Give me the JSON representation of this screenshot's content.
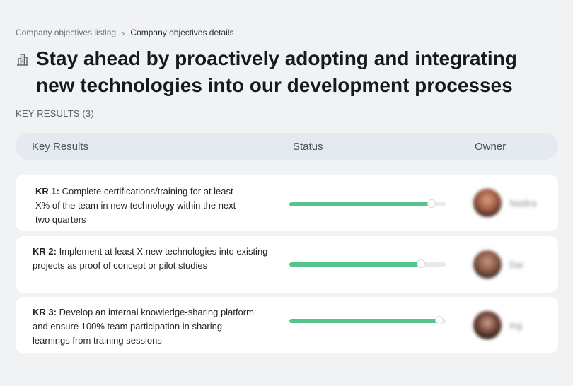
{
  "breadcrumb": {
    "parent": "Company objectives listing",
    "separator": "›",
    "current": "Company objectives details"
  },
  "page": {
    "title_icon": "building-icon",
    "title": "Stay ahead by proactively adopting and integrating new technologies into our development processes"
  },
  "key_results_label": "KEY RESULTS (3)",
  "table": {
    "headers": {
      "key_results": "Key Results",
      "status": "Status",
      "owner": "Owner"
    },
    "rows": [
      {
        "kr_label": "KR 1:",
        "kr_text": "Complete certifications/training for at least X% of the team in new technology within the next two quarters",
        "progress": 0.91,
        "owner": "Nadira"
      },
      {
        "kr_label": "KR 2:",
        "kr_text": "Implement at least X new technologies into existing projects as proof of concept or pilot studies",
        "progress": 0.84,
        "owner": "Dai"
      },
      {
        "kr_label": "KR 3:",
        "kr_text": "Develop an internal knowledge-sharing platform and ensure 100% team participation in sharing learnings from training sessions",
        "progress": 0.96,
        "owner": "Ing"
      }
    ]
  },
  "colors": {
    "progress_fill": "#55c48a",
    "progress_track": "#e7e9ec",
    "header_bg": "#e5e9f0"
  }
}
